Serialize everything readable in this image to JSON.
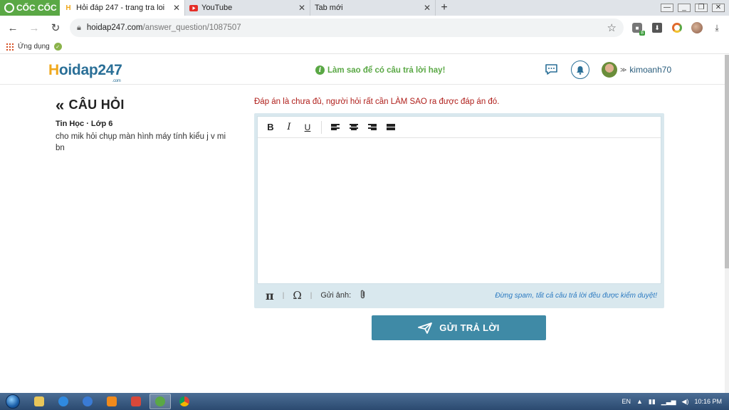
{
  "browser": {
    "brand_label": "CỐC CỐC",
    "tabs": [
      {
        "label": "Hỏi đáp 247 - trang tra loi",
        "favicon": "H",
        "active": true
      },
      {
        "label": "YouTube",
        "favicon": "youtube-icon",
        "active": false
      },
      {
        "label": "Tab mới",
        "favicon": "",
        "active": false
      }
    ],
    "new_tab": "+",
    "address": {
      "host": "hoidap247.com",
      "path": "/answer_question/1087507"
    },
    "extension_badge": "8",
    "bookmarks": {
      "apps_label": "Ứng dụng"
    }
  },
  "site": {
    "logo_main": "oidap247",
    "logo_first": "H",
    "logo_suffix": ".com",
    "tip": "Làm sao để có câu trả lời hay!",
    "username": "kimoanh70",
    "accent_color": "#2a6f97",
    "green_color": "#5aa845"
  },
  "question": {
    "back_label": "CÂU HỎI",
    "meta": "Tin Học · Lớp 6",
    "text": "cho mik hỏi chụp màn hình máy tính kiểu j v mi bn"
  },
  "answer": {
    "hint": "Đáp án là chưa đủ, người hỏi rất cần LÀM SAO ra được đáp án đó.",
    "toolbar": {
      "bold": "B",
      "italic": "I",
      "underline": "U"
    },
    "footer": {
      "pi": "π",
      "omega": "Ω",
      "separator": "|",
      "image_label": "Gửi ảnh:",
      "spam_note": "Đừng spam, tất cả câu trả lời đều được kiểm duyệt!"
    },
    "submit_label": "GỬI TRẢ LỜI",
    "submit_color": "#3f8aa6"
  },
  "taskbar": {
    "lang": "EN",
    "clock": "10:16 PM"
  }
}
